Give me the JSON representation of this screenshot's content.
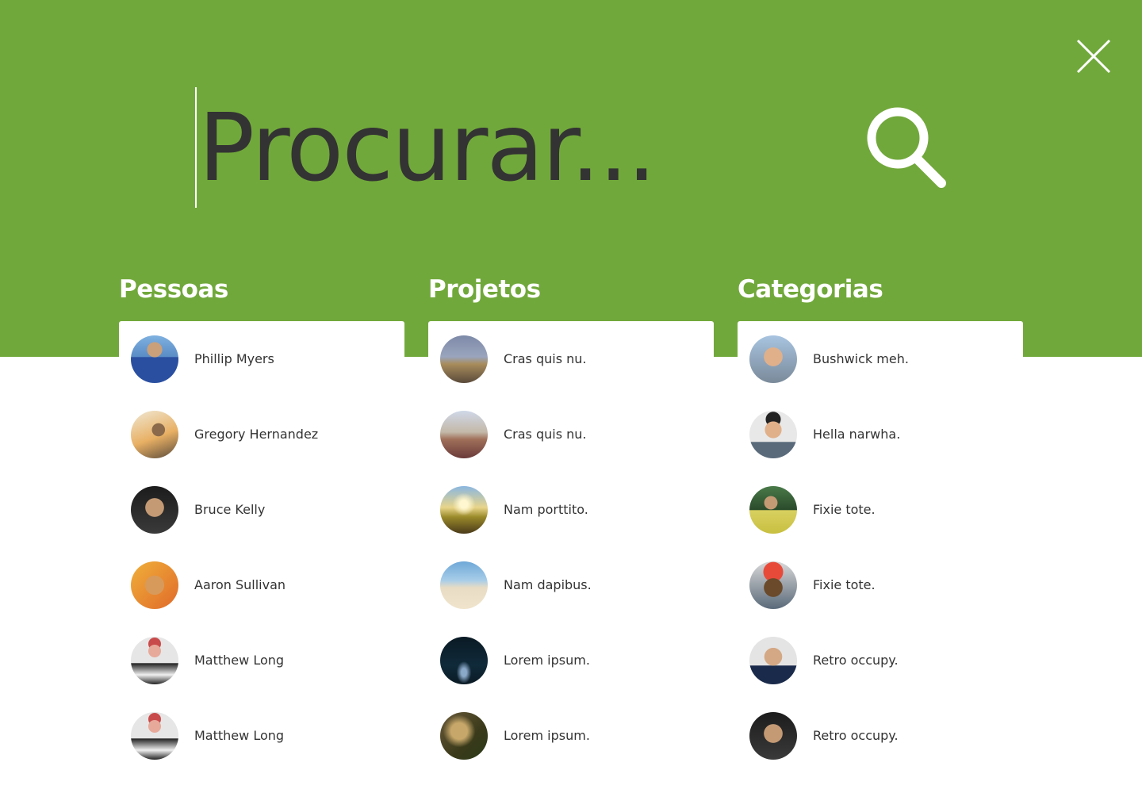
{
  "search": {
    "placeholder": "Procurar...",
    "close_icon": "close-icon",
    "search_icon": "search-icon"
  },
  "colors": {
    "accent": "#71a83b",
    "text": "#333333",
    "card": "#ffffff"
  },
  "columns": [
    {
      "heading": "Pessoas",
      "items": [
        {
          "label": "Phillip Myers"
        },
        {
          "label": "Gregory Hernandez"
        },
        {
          "label": "Bruce Kelly"
        },
        {
          "label": "Aaron Sullivan"
        },
        {
          "label": "Matthew Long"
        },
        {
          "label": "Matthew Long"
        }
      ]
    },
    {
      "heading": "Projetos",
      "items": [
        {
          "label": "Cras quis nu."
        },
        {
          "label": "Cras quis nu."
        },
        {
          "label": "Nam porttito."
        },
        {
          "label": "Nam dapibus."
        },
        {
          "label": "Lorem ipsum."
        },
        {
          "label": "Lorem ipsum."
        }
      ]
    },
    {
      "heading": "Categorias",
      "items": [
        {
          "label": "Bushwick meh."
        },
        {
          "label": "Hella narwha."
        },
        {
          "label": "Fixie tote."
        },
        {
          "label": "Fixie tote."
        },
        {
          "label": "Retro occupy."
        },
        {
          "label": "Retro occupy."
        }
      ]
    }
  ]
}
